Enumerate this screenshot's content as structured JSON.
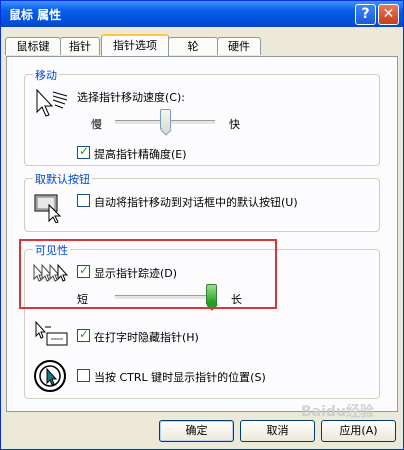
{
  "window": {
    "title": "鼠标 属性"
  },
  "titlebar_buttons": {
    "help": "?",
    "close": "✕"
  },
  "tabs": [
    {
      "label": "鼠标键",
      "active": false
    },
    {
      "label": "指针",
      "active": false
    },
    {
      "label": "指针选项",
      "active": true
    },
    {
      "label": "轮",
      "active": false
    },
    {
      "label": "硬件",
      "active": false
    }
  ],
  "motion": {
    "title": "移动",
    "speed_label": "选择指针移动速度(C):",
    "slow_label": "慢",
    "fast_label": "快",
    "speed_level": 0.5,
    "precision_label": "提高指针精确度(E)",
    "precision_checked": true
  },
  "snap_to": {
    "title": "取默认按钮",
    "label": "自动将指针移动到对话框中的默认按钮(U)",
    "checked": false
  },
  "visibility": {
    "title": "可见性",
    "trails_label": "显示指针踪迹(D)",
    "trails_checked": true,
    "short_label": "短",
    "long_label": "长",
    "trail_level": 0.9,
    "hide_typing_label": "在打字时隐藏指针(H)",
    "hide_typing_checked": true,
    "ctrl_label": "当按 CTRL 键时显示指针的位置(S)",
    "ctrl_checked": false
  },
  "buttons": {
    "ok": "确定",
    "cancel": "取消",
    "apply": "应用(A)"
  },
  "watermark": "Baidu经验",
  "colors": {
    "titlebar": "#0a5ee8",
    "group_title": "#0046d5",
    "highlight_box": "#d9363a"
  }
}
